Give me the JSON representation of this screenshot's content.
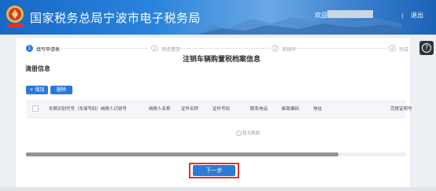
{
  "header": {
    "site_title": "国家税务总局宁波市电子税务局",
    "welcome_label": "欢迎",
    "separator": "|",
    "logout_label": "退出"
  },
  "help_icon_glyph": "?",
  "steps": [
    {
      "number": "1",
      "label": "填写申请表",
      "state": "active"
    },
    {
      "number": "2",
      "label": "预览提交",
      "state": "idle"
    },
    {
      "number": "3",
      "label": "审核中",
      "state": "idle"
    },
    {
      "number": "4",
      "label": "完成",
      "state": "idle"
    }
  ],
  "page_title": "注销车辆购置税档案信息",
  "section_title": "清册信息",
  "toolbar": {
    "add_label": "+ 增加",
    "delete_label": "删除"
  },
  "table": {
    "columns": [
      "车辆识别代号（车架号码）",
      "纳税人识别号",
      "纳税人名称",
      "证件名称",
      "证件号码",
      "联系电话",
      "邮政编码",
      "地址",
      "完税证明号"
    ],
    "empty_text": "暂无数据"
  },
  "next_button_label": "下一步",
  "colors": {
    "primary": "#2b7ad8",
    "highlight": "#e0322f",
    "header_blue": "#1769c6"
  }
}
